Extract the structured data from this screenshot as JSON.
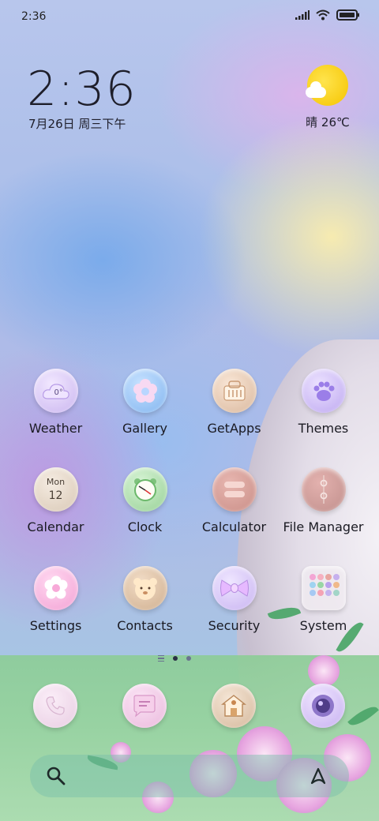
{
  "status": {
    "time": "2:36"
  },
  "clock_widget": {
    "time": "2:36",
    "date": "7月26日 周三下午"
  },
  "weather_widget": {
    "condition_temp": "晴 26℃",
    "icon": "sun-cloud-icon"
  },
  "apps": [
    {
      "label": "Weather",
      "icon": "weather-icon",
      "badge": "0°"
    },
    {
      "label": "Gallery",
      "icon": "flower-icon"
    },
    {
      "label": "GetApps",
      "icon": "store-icon"
    },
    {
      "label": "Themes",
      "icon": "paw-icon"
    },
    {
      "label": "Calendar",
      "icon": "calendar-icon",
      "day": "Mon",
      "date": "12"
    },
    {
      "label": "Clock",
      "icon": "alarm-clock-icon"
    },
    {
      "label": "Calculator",
      "icon": "calculator-icon"
    },
    {
      "label": "File Manager",
      "icon": "folder-icon"
    },
    {
      "label": "Settings",
      "icon": "gear-flower-icon"
    },
    {
      "label": "Contacts",
      "icon": "bear-icon"
    },
    {
      "label": "Security",
      "icon": "bow-icon"
    },
    {
      "label": "System",
      "icon": "app-folder-icon"
    }
  ],
  "dock": [
    {
      "icon": "phone-icon"
    },
    {
      "icon": "message-icon"
    },
    {
      "icon": "house-icon"
    },
    {
      "icon": "camera-icon"
    }
  ],
  "search": {
    "icon": "search-icon",
    "assistant_icon": "assistant-icon"
  }
}
